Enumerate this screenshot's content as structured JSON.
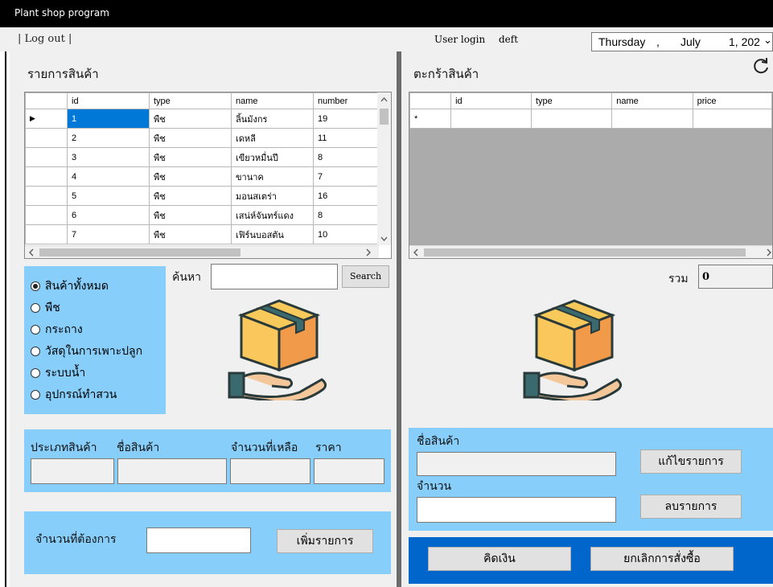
{
  "window": {
    "title": "Plant shop program"
  },
  "topbar": {
    "logout": "| Log out |",
    "user_login_label": "User login",
    "username": "deft",
    "date": {
      "weekday": "Thursday",
      "sep1": ",",
      "month": "July",
      "day_year": "1, 202",
      "chevron": "⌄"
    }
  },
  "products": {
    "heading": "รายการสินค้า",
    "columns": [
      "id",
      "type",
      "name",
      "number"
    ],
    "rows": [
      [
        "1",
        "พืช",
        "ลิ้นมังกร",
        "19"
      ],
      [
        "2",
        "พืช",
        "เดหลี",
        "11"
      ],
      [
        "3",
        "พืช",
        "เขียวหมื่นปี",
        "8"
      ],
      [
        "4",
        "พืช",
        "ขานาค",
        "7"
      ],
      [
        "5",
        "พืช",
        "มอนสเตร่า",
        "16"
      ],
      [
        "6",
        "พืช",
        "เสน่ห์จันทร์แดง",
        "8"
      ],
      [
        "7",
        "พืช",
        "เฟิร์นบอสตัน",
        "10"
      ]
    ],
    "row_marker": "▶"
  },
  "filter": {
    "options": [
      "สินค้าทั้งหมด",
      "พืช",
      "กระถาง",
      "วัสดุในการเพาะปลูก",
      "ระบบน้ำ",
      "อุปกรณ์ทำสวน"
    ],
    "selected_index": 0
  },
  "search": {
    "label": "ค้นหา",
    "value": "",
    "button": "Search"
  },
  "details": {
    "type_label": "ประเภทสินค้า",
    "name_label": "ชื่อสินค้า",
    "remaining_label": "จำนวนที่เหลือ",
    "price_label": "ราคา"
  },
  "add": {
    "quantity_label": "จำนวนที่ต้องการ",
    "quantity_value": "",
    "add_button": "เพิ่มรายการ"
  },
  "cart": {
    "heading": "ตะกร้าสินค้า",
    "columns": [
      "id",
      "type",
      "name",
      "price"
    ],
    "new_row_marker": "*",
    "total_label": "รวม",
    "total_value": "0"
  },
  "edit": {
    "name_label": "ชื่อสินค้า",
    "qty_label": "จำนวน",
    "edit_button": "แก้ไขรายการ",
    "delete_button": "ลบรายการ"
  },
  "checkout": {
    "pay_button": "คิดเงิน",
    "cancel_button": "ยกเลิกการสั่งซื้อ"
  },
  "icons": {
    "refresh": "refresh-icon",
    "box_hand": "box-in-hand-icon"
  },
  "colors": {
    "panel_blue": "#87cefa",
    "dark_blue": "#0066cc",
    "selection": "#0078d7"
  }
}
